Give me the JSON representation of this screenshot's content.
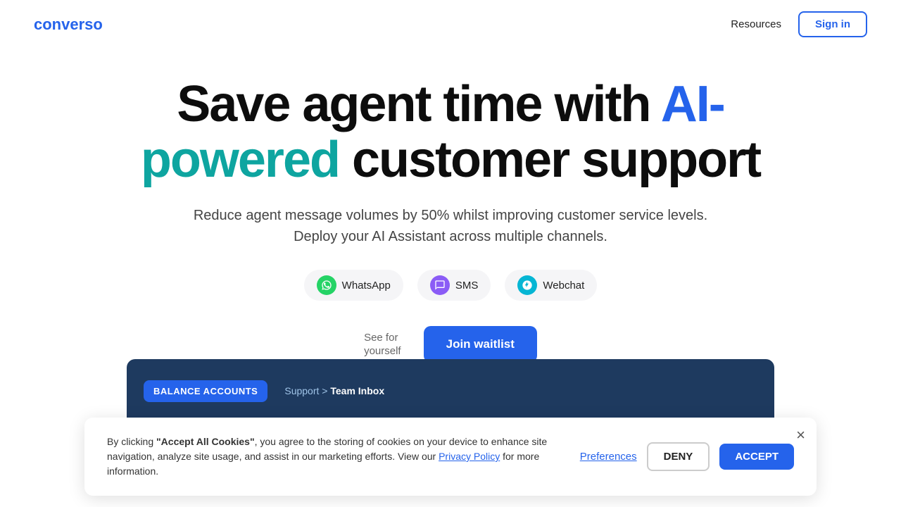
{
  "nav": {
    "logo_text": "converso",
    "resources_label": "Resources",
    "signin_label": "Sign in"
  },
  "hero": {
    "title_part1": "Save agent time with ",
    "title_highlight1": "AI-",
    "title_highlight2": "powered",
    "title_part2": " customer support",
    "subtitle": "Reduce agent message volumes by 50% whilst improving customer service levels. Deploy your AI Assistant across multiple channels."
  },
  "channels": [
    {
      "name": "WhatsApp",
      "icon_type": "whatsapp",
      "icon_char": "✓"
    },
    {
      "name": "SMS",
      "icon_type": "sms",
      "icon_char": "✉"
    },
    {
      "name": "Webchat",
      "icon_type": "webchat",
      "icon_char": "💬"
    }
  ],
  "cta": {
    "see_label_line1": "See for",
    "see_label_line2": "yourself",
    "join_label": "Join waitlist"
  },
  "bottom_strip": {
    "badge": "BALANCE ACCOUNTS",
    "breadcrumb": "Support > Team Inbox"
  },
  "cookie": {
    "text_before_bold": "By clicking ",
    "bold_text": "\"Accept All Cookies\"",
    "text_after_bold": ", you agree to the storing of cookies on your device to enhance site navigation, analyze site usage, and assist in our marketing efforts. View our ",
    "link_text": "Privacy Policy",
    "text_end": " for more information.",
    "preferences_label": "Preferences",
    "deny_label": "DENY",
    "accept_label": "ACCEPT"
  }
}
